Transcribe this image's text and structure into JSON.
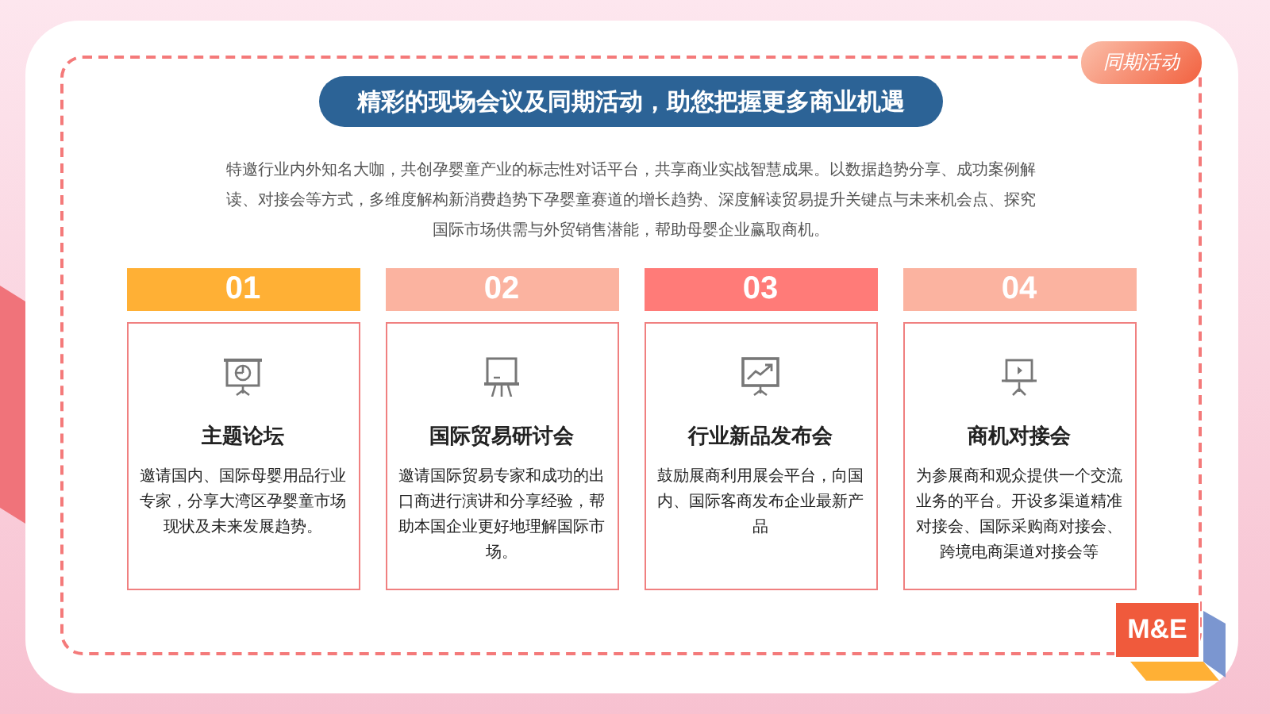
{
  "tag": "同期活动",
  "title": "精彩的现场会议及同期活动，助您把握更多商业机遇",
  "intro": "特邀行业内外知名大咖，共创孕婴童产业的标志性对话平台，共享商业实战智慧成果。以数据趋势分享、成功案例解读、对接会等方式，多维度解构新消费趋势下孕婴童赛道的增长趋势、深度解读贸易提升关键点与未来机会点、探究国际市场供需与外贸销售潜能，帮助母婴企业赢取商机。",
  "activities": [
    {
      "number": "01",
      "color": "#ffb035",
      "title": "主题论坛",
      "description": "邀请国内、国际母婴用品行业专家，分享大湾区孕婴童市场现状及未来发展趋势。"
    },
    {
      "number": "02",
      "color": "#fbb3a0",
      "title": "国际贸易研讨会",
      "description": "邀请国际贸易专家和成功的出口商进行演讲和分享经验，帮助本国企业更好地理解国际市场。"
    },
    {
      "number": "03",
      "color": "#ff7b78",
      "title": "行业新品发布会",
      "description": "鼓励展商利用展会平台，向国内、国际客商发布企业最新产品"
    },
    {
      "number": "04",
      "color": "#fbb3a0",
      "title": "商机对接会",
      "description": "为参展商和观众提供一个交流业务的平台。开设多渠道精准对接会、国际采购商对接会、跨境电商渠道对接会等"
    }
  ],
  "logo": "M&E"
}
